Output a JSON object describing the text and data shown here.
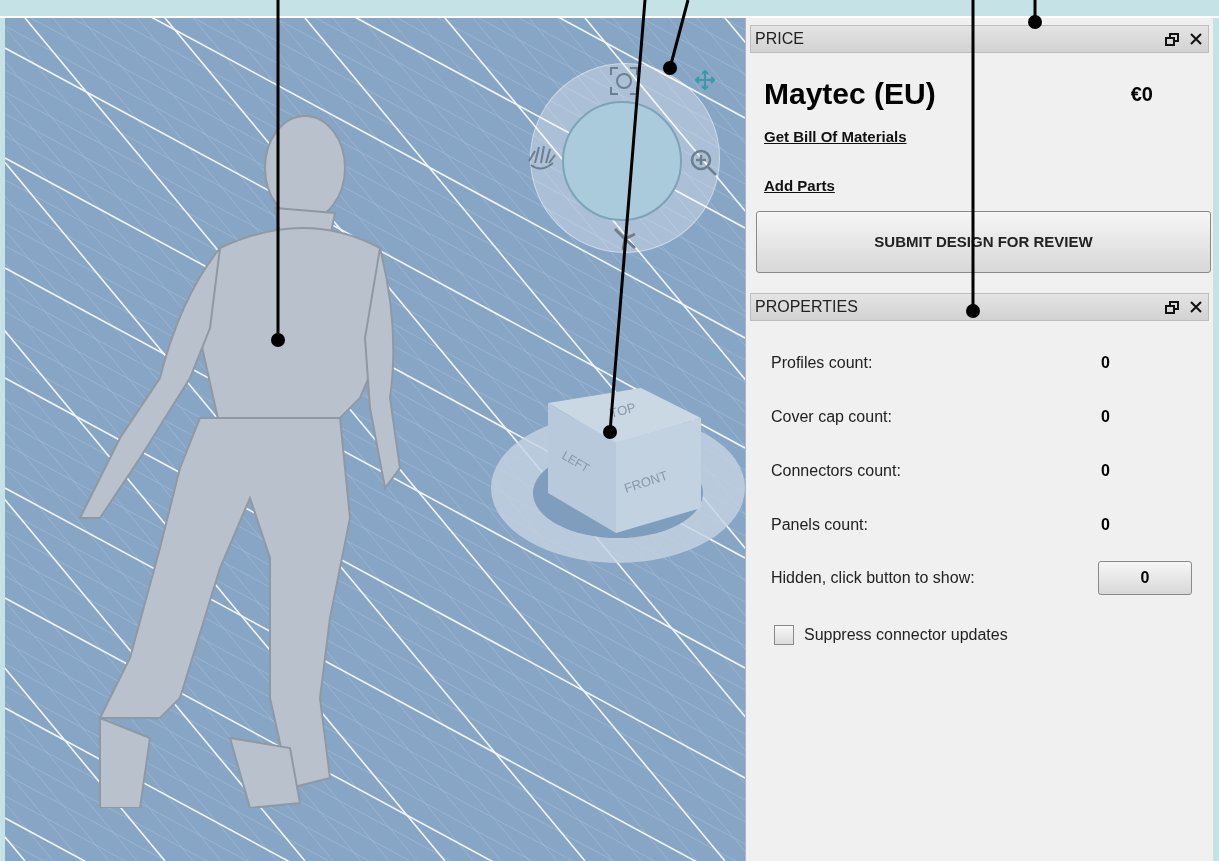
{
  "viewport": {
    "view_cube_faces": [
      "TOP",
      "LEFT",
      "FRONT"
    ]
  },
  "price_panel": {
    "title": "PRICE",
    "supplier": "Maytec (EU)",
    "total": "€0",
    "links": [
      "Get Bill Of Materials",
      "Add Parts"
    ],
    "submit_button": "SUBMIT DESIGN FOR REVIEW"
  },
  "properties_panel": {
    "title": "PROPERTIES",
    "counts": [
      {
        "label": "Profiles count:",
        "value": "0"
      },
      {
        "label": "Cover cap count:",
        "value": "0"
      },
      {
        "label": "Connectors count:",
        "value": "0"
      },
      {
        "label": "Panels count:",
        "value": "0"
      }
    ],
    "hidden": {
      "label": "Hidden, click button to show:",
      "button": "0"
    },
    "suppress": {
      "label": "Suppress connector updates",
      "checked": false
    }
  }
}
